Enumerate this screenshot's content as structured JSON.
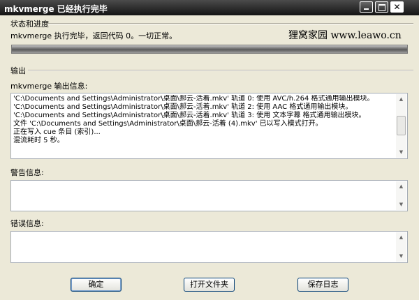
{
  "window": {
    "title": "mkvmerge 已经执行完毕",
    "icons": [
      "minimize-icon",
      "maximize-icon",
      "close-icon"
    ]
  },
  "status": {
    "group_label": "状态和进度",
    "message": "mkvmerge 执行完毕，返回代码 0。一切正常。",
    "progress_percent": 100
  },
  "watermark": "狸窝家园 www.leawo.cn",
  "output": {
    "group_label": "输出",
    "info_label": "mkvmerge 输出信息:",
    "lines": [
      "'C:\\Documents and Settings\\Administrator\\桌面\\郝云-活着.mkv' 轨道 0: 使用 AVC/h.264 格式通用输出模块。",
      "'C:\\Documents and Settings\\Administrator\\桌面\\郝云-活着.mkv' 轨道 2: 使用 AAC 格式通用输出模块。",
      "'C:\\Documents and Settings\\Administrator\\桌面\\郝云-活着.mkv' 轨道 3: 使用 文本字幕 格式通用输出模块。",
      "文件 'C:\\Documents and Settings\\Administrator\\桌面\\郝云-活着 (4).mkv' 已以写入模式打开。",
      "正在写入 cue 条目 (索引)...",
      "混流耗时 5 秒。"
    ],
    "warnings_label": "警告信息:",
    "errors_label": "错误信息:"
  },
  "buttons": {
    "ok": "确定",
    "open_folder": "打开文件夹",
    "save_log": "保存日志"
  },
  "colors": {
    "titlebar": "#141414",
    "dialog_bg": "#ece9d8",
    "progress_fill": "#6e6e6e"
  }
}
